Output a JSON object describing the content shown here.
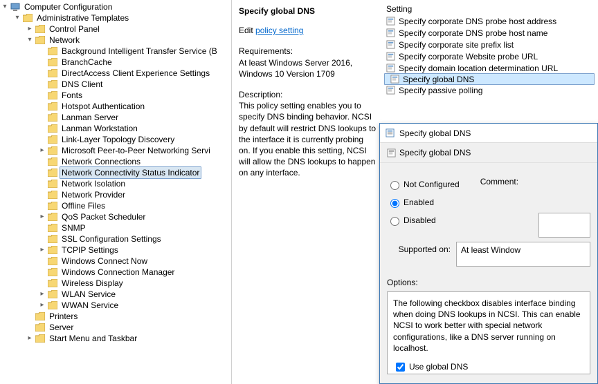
{
  "tree": {
    "root": "Computer Configuration",
    "admin": "Administrative Templates",
    "control_panel": "Control Panel",
    "network": "Network",
    "children": [
      "Background Intelligent Transfer Service (B",
      "BranchCache",
      "DirectAccess Client Experience Settings",
      "DNS Client",
      "Fonts",
      "Hotspot Authentication",
      "Lanman Server",
      "Lanman Workstation",
      "Link-Layer Topology Discovery",
      "Microsoft Peer-to-Peer Networking Servi",
      "Network Connections",
      "Network Connectivity Status Indicator",
      "Network Isolation",
      "Network Provider",
      "Offline Files",
      "QoS Packet Scheduler",
      "SNMP",
      "SSL Configuration Settings",
      "TCPIP Settings",
      "Windows Connect Now",
      "Windows Connection Manager",
      "Wireless Display",
      "WLAN Service",
      "WWAN Service"
    ],
    "printers": "Printers",
    "server": "Server",
    "start_menu": "Start Menu and Taskbar"
  },
  "details": {
    "title": "Specify global DNS",
    "edit_prefix": "Edit ",
    "edit_link": "policy setting ",
    "req_label": "Requirements:",
    "req_text": "At least Windows Server 2016, Windows 10 Version 1709",
    "desc_label": "Description:",
    "desc_text": "This policy setting enables you to specify DNS binding behavior. NCSI by default will restrict DNS lookups to the interface it is currently probing on. If you enable this setting, NCSI will allow the DNS lookups to happen on any interface."
  },
  "settings": {
    "header": "Setting",
    "items": [
      "Specify corporate DNS probe host address",
      "Specify corporate DNS probe host name",
      "Specify corporate site prefix list",
      "Specify corporate Website probe URL",
      "Specify domain location determination URL",
      "Specify global DNS",
      "Specify passive polling"
    ],
    "selected_index": 5
  },
  "dialog": {
    "title": "Specify global DNS",
    "subtitle": "Specify global DNS",
    "radios": {
      "not_configured": "Not Configured",
      "enabled": "Enabled",
      "disabled": "Disabled"
    },
    "selected_radio": "enabled",
    "comment_label": "Comment:",
    "supported_label": "Supported on:",
    "supported_text": "At least Window",
    "options_label": "Options:",
    "options_text": "The following checkbox disables interface binding when doing DNS lookups in NCSI.   This can enable NCSI to work better with special network configurations, like a DNS server running on localhost.",
    "checkbox_label": "Use global DNS",
    "checkbox_checked": true
  }
}
